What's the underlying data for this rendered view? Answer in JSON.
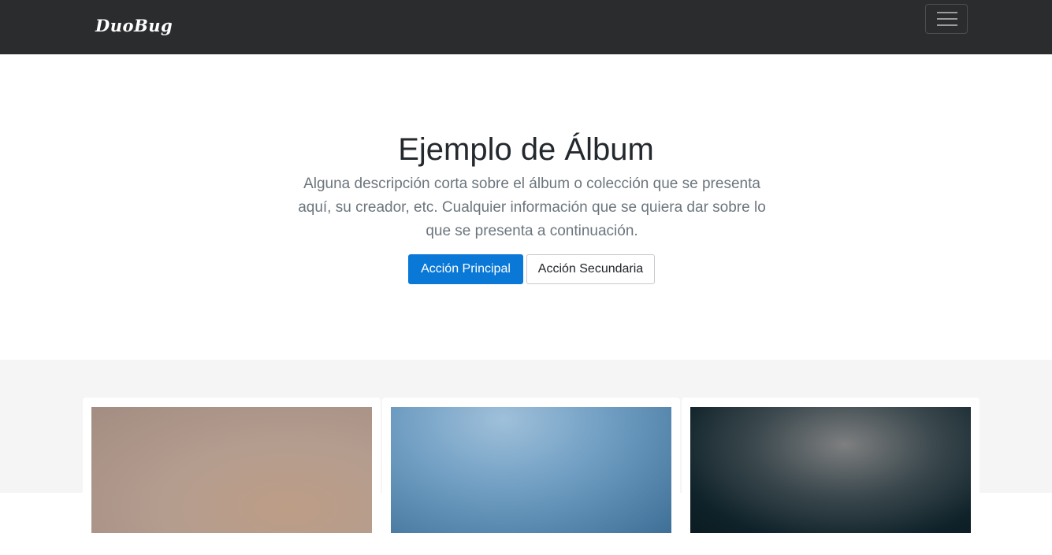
{
  "navbar": {
    "brand": "DuoBug",
    "toggler_icon": "hamburger-menu-icon"
  },
  "hero": {
    "title": "Ejemplo de Álbum",
    "description": "Alguna descripción corta sobre el álbum o colección que se presenta aquí, su creador, etc. Cualquier información que se quiera dar sobre lo que se presenta a continuación.",
    "primary_button": "Acción Principal",
    "secondary_button": "Acción Secundaria"
  },
  "colors": {
    "navbar_bg": "#2b2c2e",
    "primary": "#0a78d7",
    "album_bg": "#f5f5f5"
  }
}
